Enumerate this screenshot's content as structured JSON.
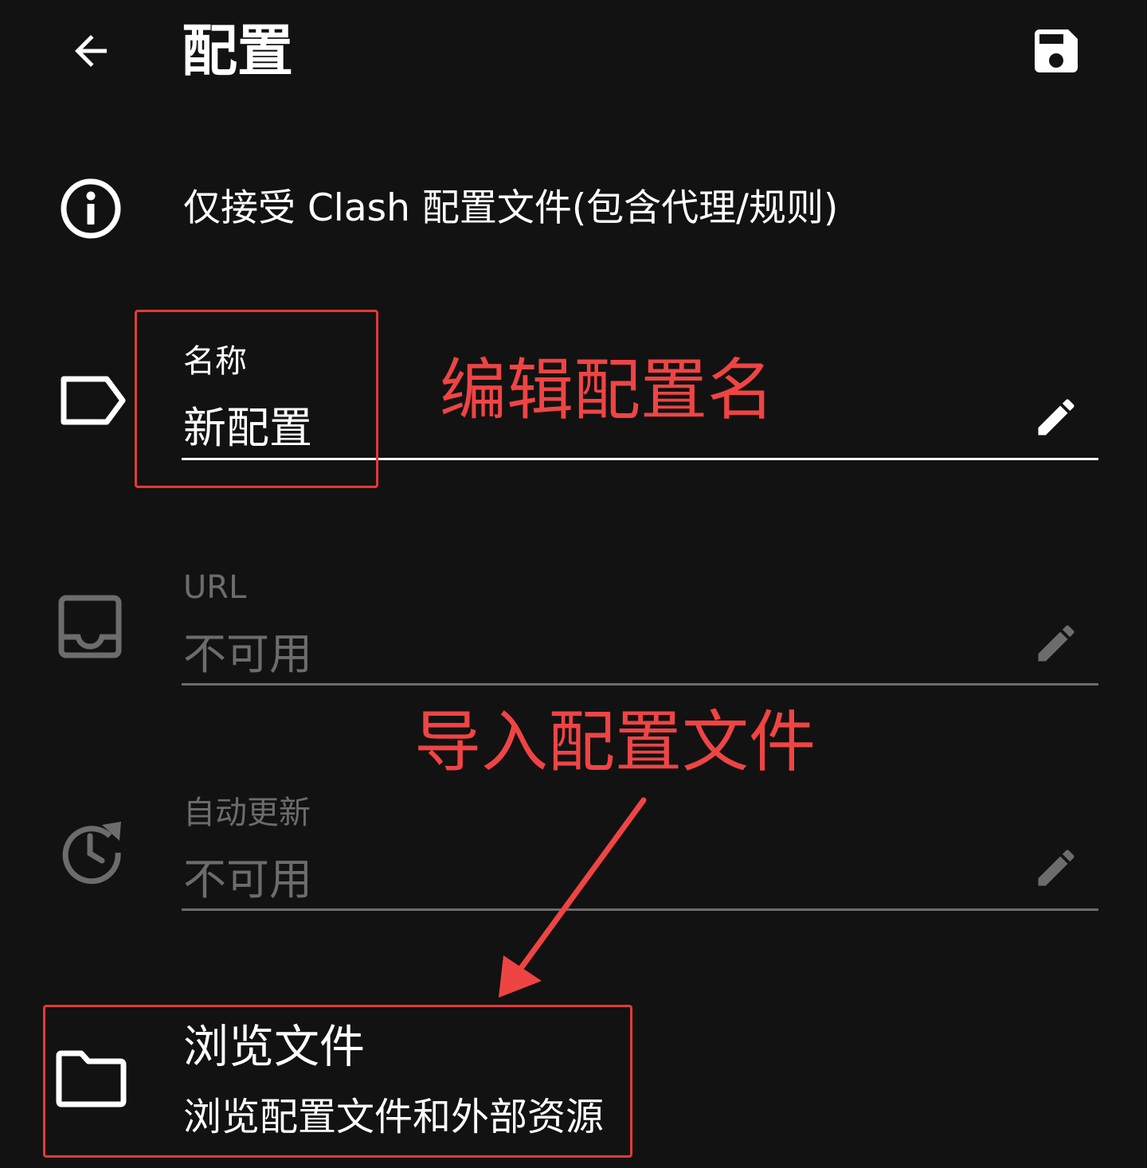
{
  "appbar": {
    "title": "配置",
    "back_icon": "arrow-left-icon",
    "save_icon": "save-icon"
  },
  "info": {
    "icon": "info-icon",
    "text": "仅接受 Clash 配置文件(包含代理/规则)"
  },
  "fields": {
    "name": {
      "icon": "label-tag-icon",
      "label": "名称",
      "value": "新配置",
      "edit_icon": "pencil-icon",
      "enabled": true
    },
    "url": {
      "icon": "inbox-icon",
      "label": "URL",
      "value": "不可用",
      "edit_icon": "pencil-icon",
      "enabled": false
    },
    "auto_update": {
      "icon": "update-clock-icon",
      "label": "自动更新",
      "value": "不可用",
      "edit_icon": "pencil-icon",
      "enabled": false
    }
  },
  "browse": {
    "icon": "folder-icon",
    "title": "浏览文件",
    "summary": "浏览配置文件和外部资源"
  },
  "annotations": {
    "edit_name": "编辑配置名",
    "import_file": "导入配置文件",
    "color": "#ef4444"
  },
  "colors": {
    "background": "#121212",
    "text": "#ffffff",
    "disabled": "#6c6c6c",
    "annotation_red": "#e53935"
  }
}
